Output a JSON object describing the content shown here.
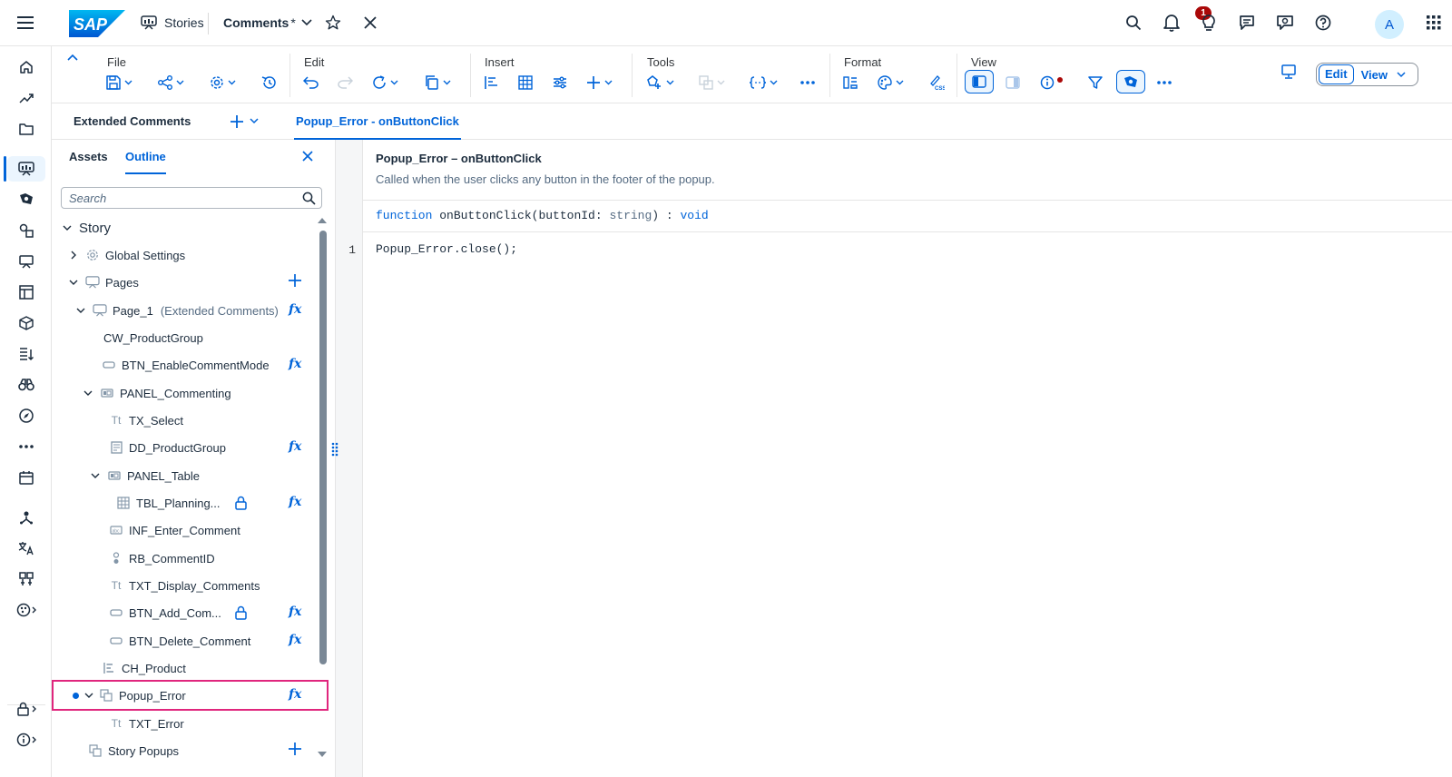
{
  "shell": {
    "logo_text": "SAP",
    "stories_label": "Stories",
    "doc_title": "Comments",
    "doc_modified": "*",
    "notification_count": "1",
    "avatar_initial": "A"
  },
  "toolbar": {
    "groups": {
      "file": "File",
      "edit": "Edit",
      "insert": "Insert",
      "tools": "Tools",
      "format": "Format",
      "view": "View"
    },
    "mode_edit": "Edit",
    "mode_view": "View"
  },
  "tabs": {
    "section_title": "Extended Comments",
    "active_tab": "Popup_Error - onButtonClick"
  },
  "left_panel": {
    "tab_assets": "Assets",
    "tab_outline": "Outline",
    "search_placeholder": "Search",
    "tree": [
      {
        "label": "Story",
        "sub": ""
      },
      {
        "label": "Global Settings",
        "sub": ""
      },
      {
        "label": "Pages",
        "sub": ""
      },
      {
        "label": "Page_1",
        "sub": "(Extended Comments)"
      },
      {
        "label": "CW_ProductGroup",
        "sub": ""
      },
      {
        "label": "BTN_EnableCommentMode",
        "sub": ""
      },
      {
        "label": "PANEL_Commenting",
        "sub": ""
      },
      {
        "label": "TX_Select",
        "sub": ""
      },
      {
        "label": "DD_ProductGroup",
        "sub": ""
      },
      {
        "label": "PANEL_Table",
        "sub": ""
      },
      {
        "label": "TBL_Planning...",
        "sub": ""
      },
      {
        "label": "INF_Enter_Comment",
        "sub": ""
      },
      {
        "label": "RB_CommentID",
        "sub": ""
      },
      {
        "label": "TXT_Display_Comments",
        "sub": ""
      },
      {
        "label": "BTN_Add_Com...",
        "sub": ""
      },
      {
        "label": "BTN_Delete_Comment",
        "sub": ""
      },
      {
        "label": "CH_Product",
        "sub": ""
      },
      {
        "label": "Popup_Error",
        "sub": ""
      },
      {
        "label": "TXT_Error",
        "sub": ""
      },
      {
        "label": "Story Popups",
        "sub": ""
      }
    ]
  },
  "editor": {
    "title": "Popup_Error – onButtonClick",
    "description": "Called when the user clicks any button in the footer of the popup.",
    "sig_keyword": "function",
    "sig_name": " onButtonClick(buttonId: ",
    "sig_param_type": "string",
    "sig_close": ") : ",
    "sig_return": "void",
    "line_number": "1",
    "code_line": "Popup_Error.close();"
  },
  "colors": {
    "accent": "#0064d9",
    "highlight": "#e0267d",
    "badge": "#aa0808"
  }
}
